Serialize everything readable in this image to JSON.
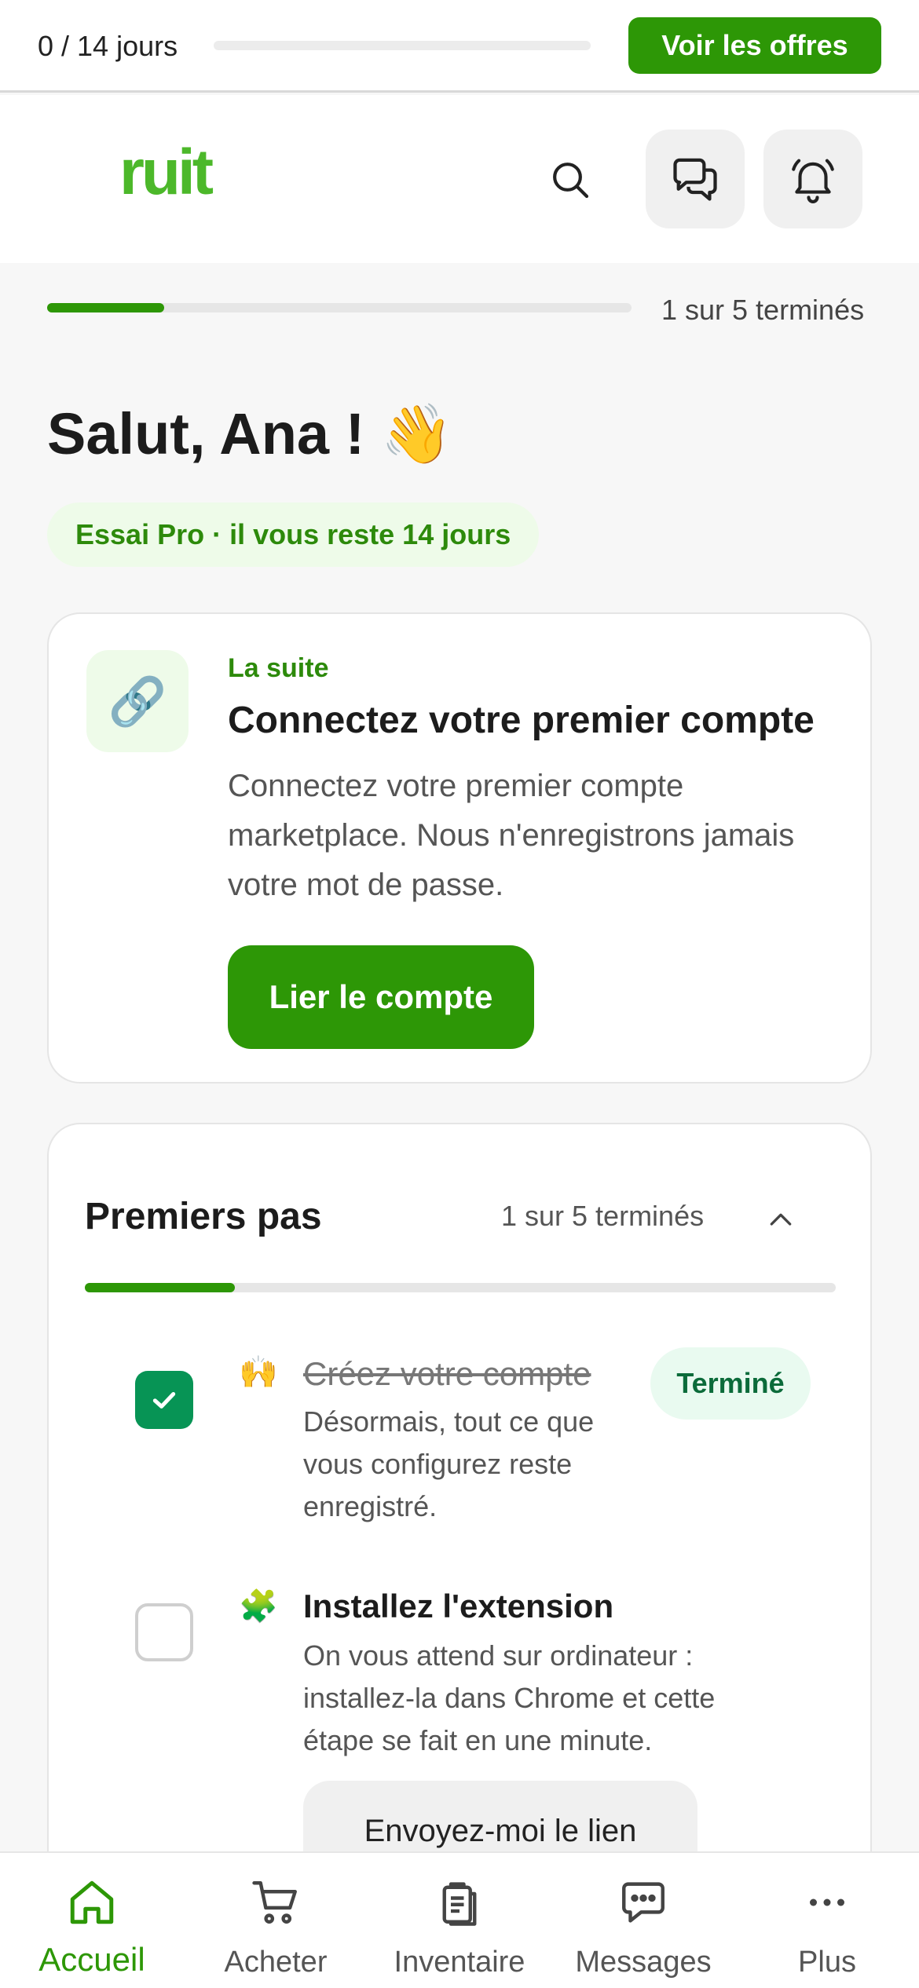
{
  "trial_bar": {
    "days_text": "0 / 14 jours",
    "progress": 0,
    "offers_label": "Voir les offres"
  },
  "header": {
    "logo": "ruit",
    "search_icon": "search-icon",
    "chat_icon": "chat-icon",
    "bell_icon": "bell-icon"
  },
  "onboarding": {
    "progress_text": "1 sur 5 terminés",
    "completed": 1,
    "total": 5
  },
  "greeting": {
    "text": "Salut, Ana !",
    "emoji": "👋"
  },
  "trial_badge": "Essai Pro · il vous reste 14 jours",
  "next_card": {
    "icon": "🔗",
    "kicker": "La suite",
    "title": "Connectez votre premier compte",
    "description": "Connectez votre premier compte marketplace. Nous n'enregistrons jamais votre mot de passe.",
    "button_label": "Lier le compte"
  },
  "steps_card": {
    "title": "Premiers pas",
    "count_text": "1 sur 5 terminés",
    "steps": [
      {
        "emoji": "🙌",
        "title": "Créez votre compte",
        "description": "Désormais, tout ce que vous configurez reste enregistré.",
        "status": "Terminé",
        "checked": true
      },
      {
        "emoji": "🧩",
        "title": "Installez l'extension",
        "description": "On vous attend sur ordinateur : installez-la dans Chrome et cette étape se fait en une minute.",
        "checked": false,
        "action_label": "Envoyez-moi le lien"
      }
    ]
  },
  "bottom_nav": [
    {
      "label": "Accueil",
      "icon": "home-icon",
      "active": true
    },
    {
      "label": "Acheter",
      "icon": "cart-icon",
      "active": false
    },
    {
      "label": "Inventaire",
      "icon": "clipboard-icon",
      "active": false
    },
    {
      "label": "Messages",
      "icon": "message-icon",
      "active": false
    },
    {
      "label": "Plus",
      "icon": "more-icon",
      "active": false
    }
  ],
  "colors": {
    "accent": "#2d9706",
    "logo": "#4cb82a",
    "check": "#079455",
    "badge_bg": "#eefbe9"
  }
}
